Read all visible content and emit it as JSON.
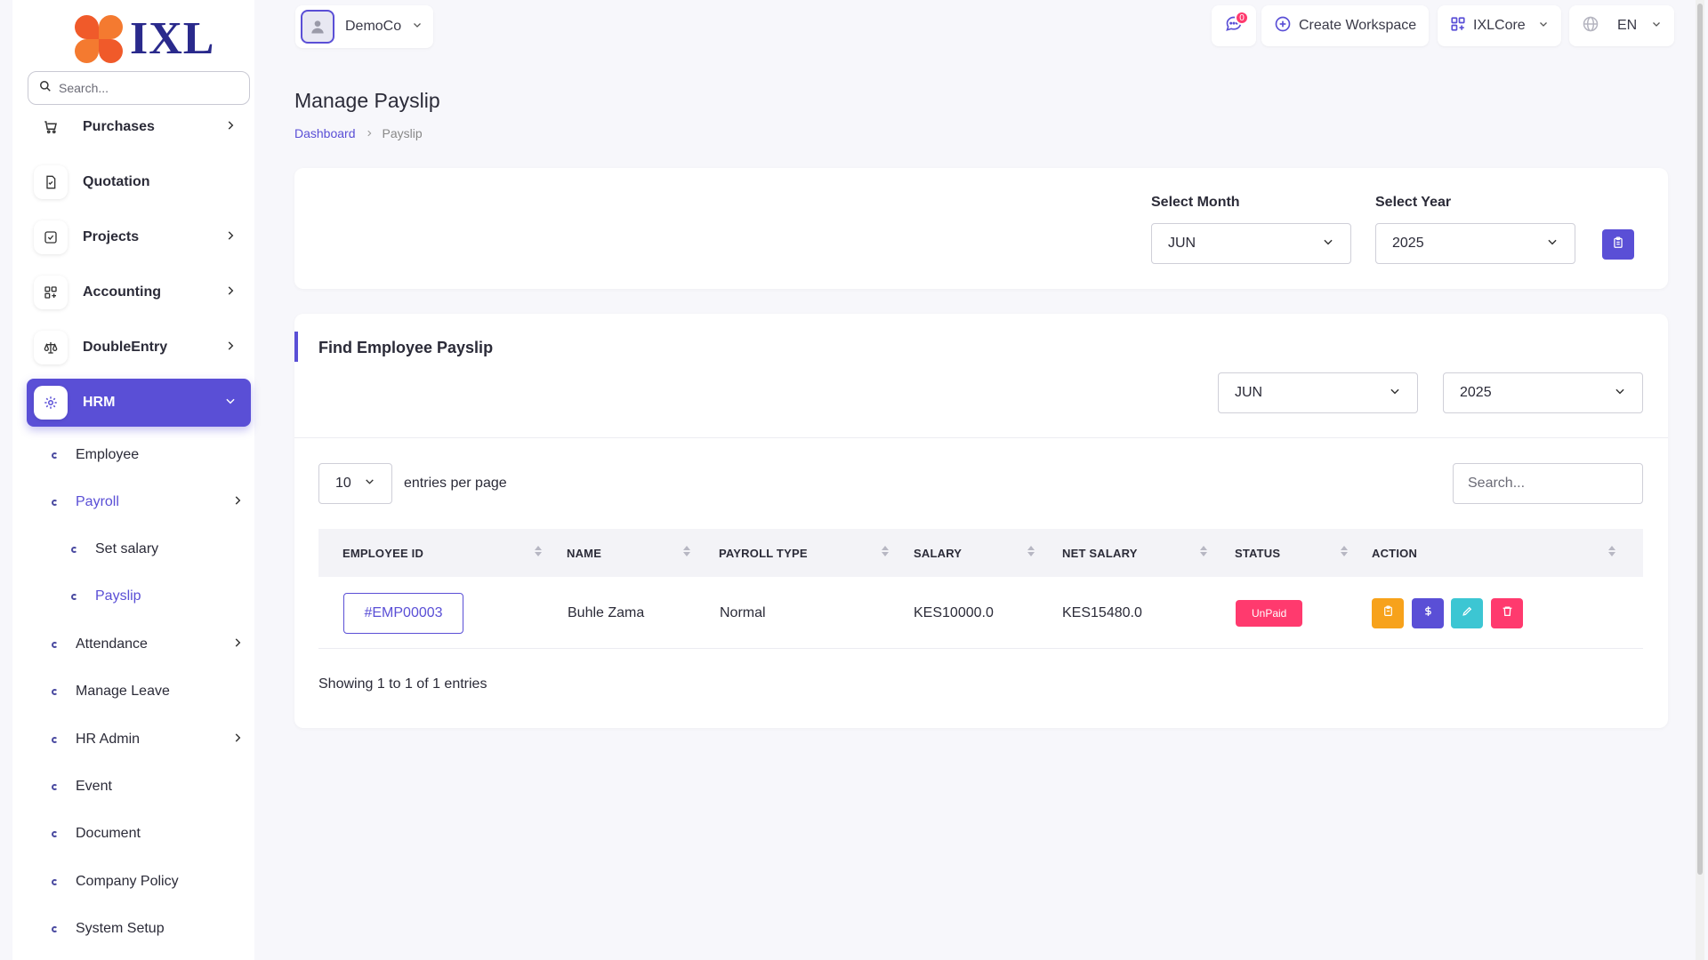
{
  "brand": {
    "name": "IXL"
  },
  "sidebar": {
    "search_placeholder": "Search...",
    "items": [
      {
        "label": "Purchases",
        "icon": "cart-icon",
        "has_children": true
      },
      {
        "label": "Quotation",
        "icon": "document-icon",
        "has_children": false
      },
      {
        "label": "Projects",
        "icon": "checkbox-icon",
        "has_children": true
      },
      {
        "label": "Accounting",
        "icon": "grid-plus-icon",
        "has_children": true
      },
      {
        "label": "DoubleEntry",
        "icon": "scale-icon",
        "has_children": true
      },
      {
        "label": "HRM",
        "icon": "hrm-icon",
        "has_children": true,
        "active": true
      }
    ],
    "hrm_children": [
      {
        "label": "Employee"
      },
      {
        "label": "Payroll",
        "active": true
      },
      {
        "label": "Set salary"
      },
      {
        "label": "Payslip",
        "active": true
      },
      {
        "label": "Attendance"
      },
      {
        "label": "Manage Leave"
      },
      {
        "label": "HR Admin"
      },
      {
        "label": "Event"
      },
      {
        "label": "Document"
      },
      {
        "label": "Company Policy"
      },
      {
        "label": "System Setup"
      }
    ]
  },
  "topbar": {
    "company": "DemoCo",
    "messages_badge": "0",
    "create_workspace": "Create Workspace",
    "workspace": "IXLCore",
    "language": "EN"
  },
  "page": {
    "title": "Manage Payslip",
    "breadcrumb": {
      "home": "Dashboard",
      "current": "Payslip"
    }
  },
  "filter_card": {
    "month_label": "Select Month",
    "month_value": "JUN",
    "year_label": "Select Year",
    "year_value": "2025"
  },
  "find_card": {
    "title": "Find Employee Payslip",
    "month_value": "JUN",
    "year_value": "2025",
    "per_page": "10",
    "per_page_label": "entries per page",
    "search_placeholder": "Search...",
    "columns": [
      "EMPLOYEE ID",
      "NAME",
      "PAYROLL TYPE",
      "SALARY",
      "NET SALARY",
      "STATUS",
      "ACTION"
    ],
    "rows": [
      {
        "employee_id": "#EMP00003",
        "name": "Buhle Zama",
        "payroll_type": "Normal",
        "salary": "KES10000.0",
        "net_salary": "KES15480.0",
        "status": "UnPaid"
      }
    ],
    "showing": "Showing 1 to 1 of 1 entries",
    "action_colors": {
      "payslip": "#f7a21b",
      "pay": "#5a4fd6",
      "edit": "#3cc6d3",
      "delete": "#ff3a6e"
    }
  },
  "colors": {
    "accent": "#5a4fd6",
    "danger": "#ff3a6e",
    "brand_orange": "#f05a2a",
    "brand_navy": "#2a2a8c"
  }
}
